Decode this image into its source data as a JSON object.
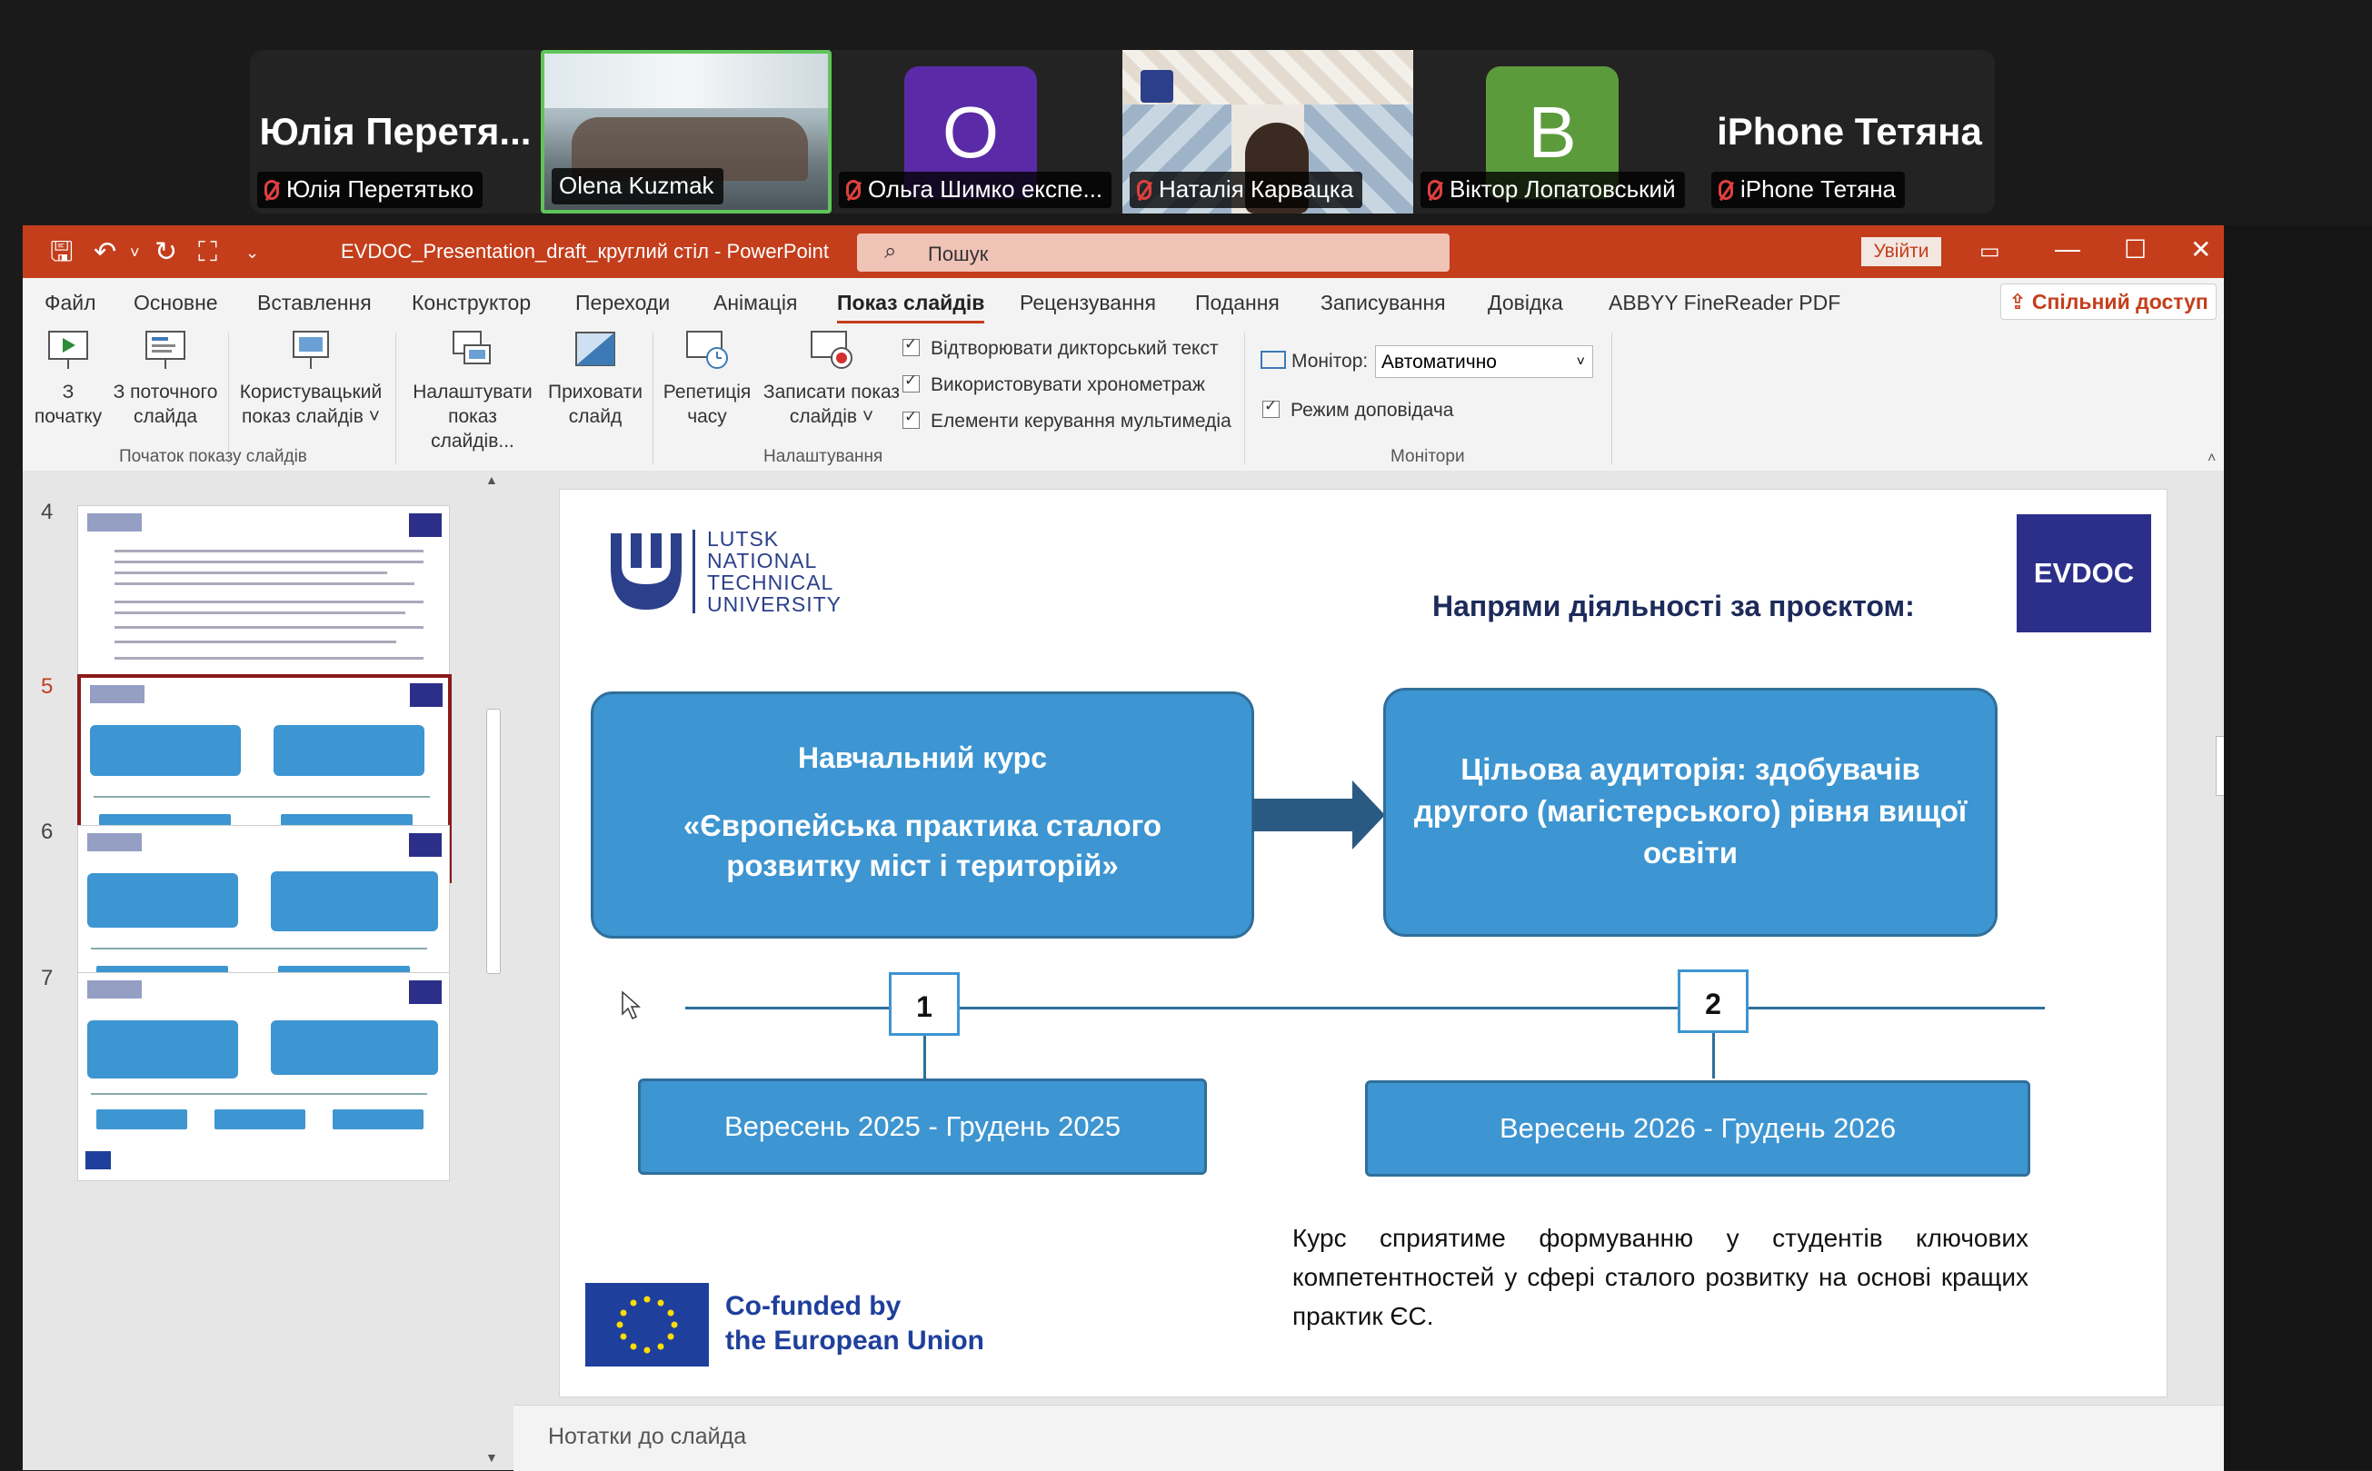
{
  "participants": [
    {
      "big_name": "Юлія Перетя...",
      "label": "Юлія Перетятько",
      "muted": true
    },
    {
      "label": "Olena Kuzmak",
      "muted": false,
      "active_speaker": true
    },
    {
      "avatar_letter": "O",
      "avatar_color": "#5b2aa6",
      "label": "Ольга Шимко експе...",
      "muted": true
    },
    {
      "label": "Наталія Карвацка",
      "muted": true
    },
    {
      "avatar_letter": "B",
      "avatar_color": "#5c9b3c",
      "label": "Віктор Лопатовський",
      "muted": true
    },
    {
      "big_name": "iPhone Тетяна",
      "label": "iPhone Тетяна",
      "muted": true
    }
  ],
  "titlebar": {
    "doc_title": "EVDOC_Presentation_draft_круглий стіл  -  PowerPoint",
    "search_placeholder": "Пошук",
    "signin_label": "Увійти",
    "accent_color": "#c43e1c"
  },
  "tabs": [
    "Файл",
    "Основне",
    "Вставлення",
    "Конструктор",
    "Переходи",
    "Анімація",
    "Показ слайдів",
    "Рецензування",
    "Подання",
    "Записування",
    "Довідка",
    "ABBYY FineReader PDF"
  ],
  "active_tab": "Показ слайдів",
  "share_label": "Спільний доступ",
  "ribbon": {
    "start_group": {
      "label": "Початок показу слайдів",
      "from_start": [
        "З",
        "початку"
      ],
      "from_current": [
        "З поточного",
        "слайда"
      ],
      "custom": [
        "Користувацький",
        "показ слайдів ˅"
      ]
    },
    "setup_group": {
      "label": "Налаштування",
      "setup_show": [
        "Налаштувати",
        "показ слайдів..."
      ],
      "hide_slide": [
        "Приховати",
        "слайд"
      ],
      "rehearse": [
        "Репетиція",
        "часу"
      ],
      "record": [
        "Записати показ",
        "слайдів ˅"
      ],
      "checks": [
        "Відтворювати дикторський текст",
        "Використовувати хронометраж",
        "Елементи керування мультимедіа"
      ]
    },
    "monitors_group": {
      "label": "Монітори",
      "monitor_label": "Монітор:",
      "monitor_value": "Автоматично",
      "presenter_view": "Режим доповідача"
    }
  },
  "thumbnails": [
    {
      "num": "4",
      "selected": false
    },
    {
      "num": "5",
      "selected": true
    },
    {
      "num": "6",
      "selected": false
    },
    {
      "num": "7",
      "selected": false
    }
  ],
  "slide": {
    "university_lines": [
      "LUTSK",
      "NATIONAL",
      "TECHNICAL",
      "UNIVERSITY"
    ],
    "evdoc_logo": "EVDOC",
    "heading": "Напрями діяльності за проєктом:",
    "box1_title": "Навчальний курс",
    "box1_subtitle": "«Європейська практика сталого розвитку міст і територій»",
    "box2_text": "Цільова аудиторія: здобувачів другого (магістерського) рівня вищої освіти",
    "step1": "1",
    "step2": "2",
    "date1": "Вересень 2025 - Грудень 2025",
    "date2": "Вересень 2026 - Грудень 2026",
    "description": "Курс сприятиме формуванню у студентів ключових компетентностей у сфері сталого розвитку на основі кращих практик ЄС.",
    "cofunded_line1": "Co-funded by",
    "cofunded_line2": "the European Union",
    "box_color": "#3d95d1",
    "eu_blue": "#1f3f9c",
    "evdoc_color": "#2b2f8a"
  },
  "notes_placeholder": "Нотатки до слайда"
}
